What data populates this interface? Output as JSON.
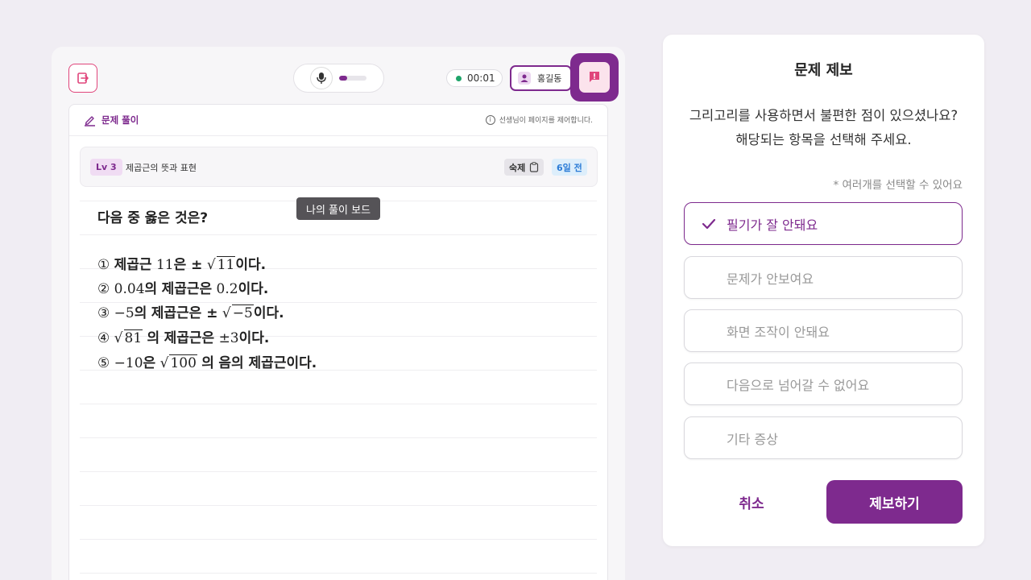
{
  "header": {
    "timer": "00:01",
    "user_name": "홍길동",
    "mic_level": 0.3
  },
  "sheet": {
    "title": "문제 풀이",
    "notice": "선생님이 페이지를 제어합니다.",
    "level": "Lv 3",
    "topic": "제곱근의 뜻과 표현",
    "homework": "숙제",
    "ago": "6일 전",
    "question": "다음 중 옳은 것은?",
    "tooltip": "나의 풀이 보드",
    "choices": [
      {
        "num": "①",
        "parts": [
          "제곱근",
          "11",
          "은 ±",
          "11",
          "이다."
        ]
      },
      {
        "num": "②",
        "parts": [
          "0.04",
          "의",
          "제곱근은",
          "0.2",
          "이다."
        ]
      },
      {
        "num": "③",
        "parts": [
          "−5",
          "의",
          "제곱근은 ±",
          "−5",
          "이다."
        ]
      },
      {
        "num": "④",
        "parts": [
          "81",
          "의",
          "제곱근은",
          "±3",
          "이다."
        ]
      },
      {
        "num": "⑤",
        "parts": [
          "−10",
          "은",
          "100",
          "의",
          "음의 제곱근이다."
        ]
      }
    ]
  },
  "report": {
    "title": "문제 제보",
    "desc_line1": "그리고리를 사용하면서 불편한 점이 있으셨나요?",
    "desc_line2": "해당되는 항목을 선택해 주세요.",
    "hint": "* 여러개를 선택할 수 있어요",
    "options": [
      {
        "label": "필기가 잘 안돼요",
        "selected": true
      },
      {
        "label": "문제가 안보여요",
        "selected": false
      },
      {
        "label": "화면 조작이 안돼요",
        "selected": false
      },
      {
        "label": "다음으로 넘어갈 수 없어요",
        "selected": false
      },
      {
        "label": "기타 증상",
        "selected": false
      }
    ],
    "cancel": "취소",
    "submit": "제보하기"
  },
  "colors": {
    "accent": "#7e2a8e",
    "exit": "#e0457b",
    "timer_dot": "#1fa46a"
  }
}
